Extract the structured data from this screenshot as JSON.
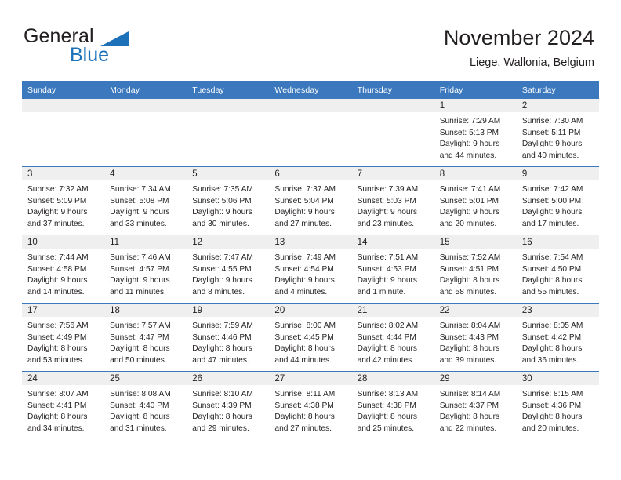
{
  "brand": {
    "name_dark": "General",
    "name_blue": "Blue",
    "triangle_icon": "triangle-icon",
    "accent_color": "#1c71b8"
  },
  "header": {
    "title": "November 2024",
    "subtitle": "Liege, Wallonia, Belgium"
  },
  "colors": {
    "header_blue": "#3b78bd",
    "daynum_band": "#efefef",
    "text": "#231f20"
  },
  "weekday_headers": [
    "Sunday",
    "Monday",
    "Tuesday",
    "Wednesday",
    "Thursday",
    "Friday",
    "Saturday"
  ],
  "weeks": [
    [
      {
        "day": "",
        "sunrise": "",
        "sunset": "",
        "daylight_line1": "",
        "daylight_line2": ""
      },
      {
        "day": "",
        "sunrise": "",
        "sunset": "",
        "daylight_line1": "",
        "daylight_line2": ""
      },
      {
        "day": "",
        "sunrise": "",
        "sunset": "",
        "daylight_line1": "",
        "daylight_line2": ""
      },
      {
        "day": "",
        "sunrise": "",
        "sunset": "",
        "daylight_line1": "",
        "daylight_line2": ""
      },
      {
        "day": "",
        "sunrise": "",
        "sunset": "",
        "daylight_line1": "",
        "daylight_line2": ""
      },
      {
        "day": "1",
        "sunrise": "Sunrise: 7:29 AM",
        "sunset": "Sunset: 5:13 PM",
        "daylight_line1": "Daylight: 9 hours",
        "daylight_line2": "and 44 minutes."
      },
      {
        "day": "2",
        "sunrise": "Sunrise: 7:30 AM",
        "sunset": "Sunset: 5:11 PM",
        "daylight_line1": "Daylight: 9 hours",
        "daylight_line2": "and 40 minutes."
      }
    ],
    [
      {
        "day": "3",
        "sunrise": "Sunrise: 7:32 AM",
        "sunset": "Sunset: 5:09 PM",
        "daylight_line1": "Daylight: 9 hours",
        "daylight_line2": "and 37 minutes."
      },
      {
        "day": "4",
        "sunrise": "Sunrise: 7:34 AM",
        "sunset": "Sunset: 5:08 PM",
        "daylight_line1": "Daylight: 9 hours",
        "daylight_line2": "and 33 minutes."
      },
      {
        "day": "5",
        "sunrise": "Sunrise: 7:35 AM",
        "sunset": "Sunset: 5:06 PM",
        "daylight_line1": "Daylight: 9 hours",
        "daylight_line2": "and 30 minutes."
      },
      {
        "day": "6",
        "sunrise": "Sunrise: 7:37 AM",
        "sunset": "Sunset: 5:04 PM",
        "daylight_line1": "Daylight: 9 hours",
        "daylight_line2": "and 27 minutes."
      },
      {
        "day": "7",
        "sunrise": "Sunrise: 7:39 AM",
        "sunset": "Sunset: 5:03 PM",
        "daylight_line1": "Daylight: 9 hours",
        "daylight_line2": "and 23 minutes."
      },
      {
        "day": "8",
        "sunrise": "Sunrise: 7:41 AM",
        "sunset": "Sunset: 5:01 PM",
        "daylight_line1": "Daylight: 9 hours",
        "daylight_line2": "and 20 minutes."
      },
      {
        "day": "9",
        "sunrise": "Sunrise: 7:42 AM",
        "sunset": "Sunset: 5:00 PM",
        "daylight_line1": "Daylight: 9 hours",
        "daylight_line2": "and 17 minutes."
      }
    ],
    [
      {
        "day": "10",
        "sunrise": "Sunrise: 7:44 AM",
        "sunset": "Sunset: 4:58 PM",
        "daylight_line1": "Daylight: 9 hours",
        "daylight_line2": "and 14 minutes."
      },
      {
        "day": "11",
        "sunrise": "Sunrise: 7:46 AM",
        "sunset": "Sunset: 4:57 PM",
        "daylight_line1": "Daylight: 9 hours",
        "daylight_line2": "and 11 minutes."
      },
      {
        "day": "12",
        "sunrise": "Sunrise: 7:47 AM",
        "sunset": "Sunset: 4:55 PM",
        "daylight_line1": "Daylight: 9 hours",
        "daylight_line2": "and 8 minutes."
      },
      {
        "day": "13",
        "sunrise": "Sunrise: 7:49 AM",
        "sunset": "Sunset: 4:54 PM",
        "daylight_line1": "Daylight: 9 hours",
        "daylight_line2": "and 4 minutes."
      },
      {
        "day": "14",
        "sunrise": "Sunrise: 7:51 AM",
        "sunset": "Sunset: 4:53 PM",
        "daylight_line1": "Daylight: 9 hours",
        "daylight_line2": "and 1 minute."
      },
      {
        "day": "15",
        "sunrise": "Sunrise: 7:52 AM",
        "sunset": "Sunset: 4:51 PM",
        "daylight_line1": "Daylight: 8 hours",
        "daylight_line2": "and 58 minutes."
      },
      {
        "day": "16",
        "sunrise": "Sunrise: 7:54 AM",
        "sunset": "Sunset: 4:50 PM",
        "daylight_line1": "Daylight: 8 hours",
        "daylight_line2": "and 55 minutes."
      }
    ],
    [
      {
        "day": "17",
        "sunrise": "Sunrise: 7:56 AM",
        "sunset": "Sunset: 4:49 PM",
        "daylight_line1": "Daylight: 8 hours",
        "daylight_line2": "and 53 minutes."
      },
      {
        "day": "18",
        "sunrise": "Sunrise: 7:57 AM",
        "sunset": "Sunset: 4:47 PM",
        "daylight_line1": "Daylight: 8 hours",
        "daylight_line2": "and 50 minutes."
      },
      {
        "day": "19",
        "sunrise": "Sunrise: 7:59 AM",
        "sunset": "Sunset: 4:46 PM",
        "daylight_line1": "Daylight: 8 hours",
        "daylight_line2": "and 47 minutes."
      },
      {
        "day": "20",
        "sunrise": "Sunrise: 8:00 AM",
        "sunset": "Sunset: 4:45 PM",
        "daylight_line1": "Daylight: 8 hours",
        "daylight_line2": "and 44 minutes."
      },
      {
        "day": "21",
        "sunrise": "Sunrise: 8:02 AM",
        "sunset": "Sunset: 4:44 PM",
        "daylight_line1": "Daylight: 8 hours",
        "daylight_line2": "and 42 minutes."
      },
      {
        "day": "22",
        "sunrise": "Sunrise: 8:04 AM",
        "sunset": "Sunset: 4:43 PM",
        "daylight_line1": "Daylight: 8 hours",
        "daylight_line2": "and 39 minutes."
      },
      {
        "day": "23",
        "sunrise": "Sunrise: 8:05 AM",
        "sunset": "Sunset: 4:42 PM",
        "daylight_line1": "Daylight: 8 hours",
        "daylight_line2": "and 36 minutes."
      }
    ],
    [
      {
        "day": "24",
        "sunrise": "Sunrise: 8:07 AM",
        "sunset": "Sunset: 4:41 PM",
        "daylight_line1": "Daylight: 8 hours",
        "daylight_line2": "and 34 minutes."
      },
      {
        "day": "25",
        "sunrise": "Sunrise: 8:08 AM",
        "sunset": "Sunset: 4:40 PM",
        "daylight_line1": "Daylight: 8 hours",
        "daylight_line2": "and 31 minutes."
      },
      {
        "day": "26",
        "sunrise": "Sunrise: 8:10 AM",
        "sunset": "Sunset: 4:39 PM",
        "daylight_line1": "Daylight: 8 hours",
        "daylight_line2": "and 29 minutes."
      },
      {
        "day": "27",
        "sunrise": "Sunrise: 8:11 AM",
        "sunset": "Sunset: 4:38 PM",
        "daylight_line1": "Daylight: 8 hours",
        "daylight_line2": "and 27 minutes."
      },
      {
        "day": "28",
        "sunrise": "Sunrise: 8:13 AM",
        "sunset": "Sunset: 4:38 PM",
        "daylight_line1": "Daylight: 8 hours",
        "daylight_line2": "and 25 minutes."
      },
      {
        "day": "29",
        "sunrise": "Sunrise: 8:14 AM",
        "sunset": "Sunset: 4:37 PM",
        "daylight_line1": "Daylight: 8 hours",
        "daylight_line2": "and 22 minutes."
      },
      {
        "day": "30",
        "sunrise": "Sunrise: 8:15 AM",
        "sunset": "Sunset: 4:36 PM",
        "daylight_line1": "Daylight: 8 hours",
        "daylight_line2": "and 20 minutes."
      }
    ]
  ]
}
